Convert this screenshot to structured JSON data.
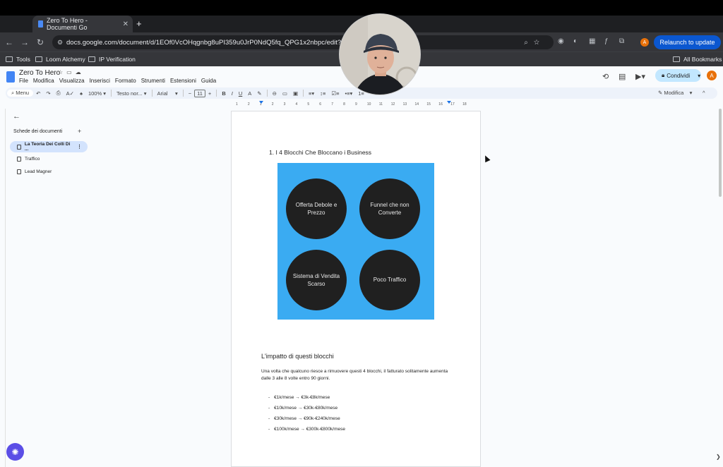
{
  "browser": {
    "tab_title": "Zero To Hero - Documenti Go",
    "url": "docs.google.com/document/d/1EOf0VcOHqgnbg8uPI359u0JrP0NdQ5fq_QPG1x2nbpc/edit?tab=t.0",
    "relaunch_label": "Relaunch to update",
    "avatar_initial": "A",
    "bookmarks": [
      "Tools",
      "Loom Alchemy",
      "IP Verification"
    ],
    "all_bookmarks": "All Bookmarks"
  },
  "docs": {
    "title": "Zero To Hero",
    "menu": [
      "File",
      "Modifica",
      "Visualizza",
      "Inserisci",
      "Formato",
      "Strumenti",
      "Estensioni",
      "Guida"
    ],
    "share_label": "Condividi",
    "avatar_initial": "A"
  },
  "toolbar": {
    "menus_label": "Menu",
    "zoom": "100%",
    "style": "Testo nor...",
    "font": "Arial",
    "font_size": "11",
    "mode": "Modifica"
  },
  "sidebar": {
    "title": "Schede dei documenti",
    "items": [
      {
        "label": "La Teoria Dei Colli Di ...",
        "active": true
      },
      {
        "label": "Traffico",
        "active": false
      },
      {
        "label": "Lead Magner",
        "active": false
      }
    ]
  },
  "document": {
    "heading1": "1.  I 4 Blocchi Che Bloccano i Business",
    "diagram": {
      "background": "#3aabf2",
      "circles": [
        "Offerta Debole e Prezzo",
        "Funnel che non Converte",
        "Sistema di Vendita Scarso",
        "Poco Traffico"
      ]
    },
    "heading2": "L'impatto di questi blocchi",
    "paragraph": "Una volta che qualcuno riesce a rimuovere questi 4 blocchi, il fatturato solitamente aumenta dalle 3 alle 8 volte entro 90 giorni.",
    "bullets": [
      "€1k/mese → €3k-€8k/mese",
      "€10k/mese → €30k-€80k/mese",
      "€30k/mese → €90k-€240k/mese",
      "€100k/mese → €300k-€800k/mese"
    ]
  },
  "ruler_ticks": [
    "1",
    "2",
    "1",
    "2",
    "3",
    "4",
    "5",
    "6",
    "7",
    "8",
    "9",
    "10",
    "11",
    "12",
    "13",
    "14",
    "15",
    "16",
    "17",
    "18"
  ]
}
